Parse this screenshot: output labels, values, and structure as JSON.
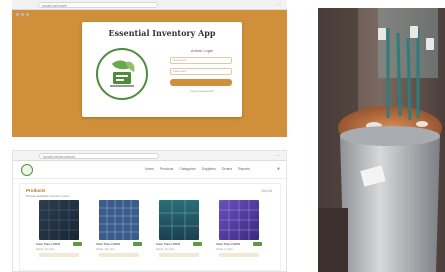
{
  "login_screenshot": {
    "browser": {
      "url": "localhost/login",
      "tools": "⋯"
    },
    "title": "Essential Inventory App",
    "form": {
      "heading": "Admin Login",
      "username_placeholder": "Username",
      "password_placeholder": "Password",
      "login_link": "Forgot password?"
    },
    "colors": {
      "background": "#d08f3a",
      "accent": "#d08f3a",
      "logo_green": "#4e8c3a"
    },
    "logo_icon": "leaf-box-logo"
  },
  "list_screenshot": {
    "browser": {
      "url": "localhost/products"
    },
    "nav": [
      "Home",
      "Products",
      "Categories",
      "Suppliers",
      "Orders",
      "Reports"
    ],
    "section_title": "Products",
    "section_subtitle": "Browse available inventory items",
    "view_all": "View All",
    "cards": [
      {
        "name": "Solar Panel 100W",
        "meta": "Stock: 24 units",
        "image": "dark-blue-solar-panel"
      },
      {
        "name": "Solar Panel 200W",
        "meta": "Stock: 18 units",
        "image": "blue-grid-solar-panel"
      },
      {
        "name": "Solar Panel 150W",
        "meta": "Stock: 12 units",
        "image": "teal-solar-panel"
      },
      {
        "name": "Solar Panel 300W",
        "meta": "Stock: 9 units",
        "image": "purple-solar-panel"
      }
    ]
  },
  "photo": {
    "subject": "motor-rewinding-photo"
  }
}
